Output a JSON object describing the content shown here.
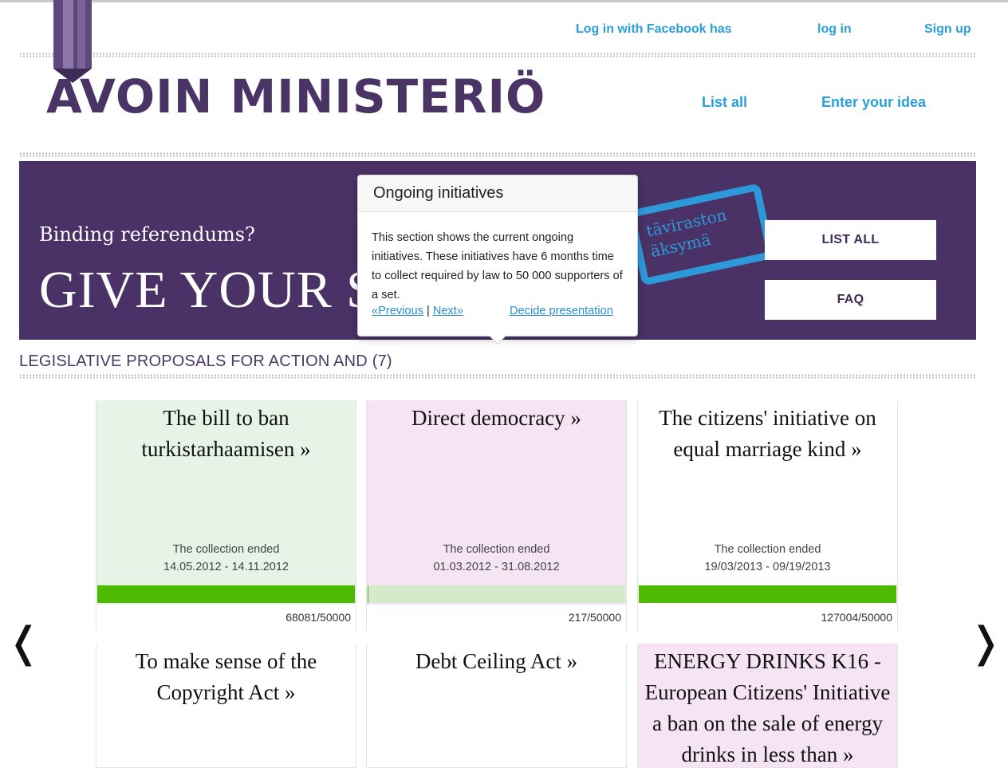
{
  "header": {
    "facebook_login": "Log in with Facebook has",
    "login": "log in",
    "signup": "Sign up",
    "logo_text": "AVOIN MINISTERIÖ",
    "nav": {
      "list_all": "List all",
      "enter_idea": "Enter your idea"
    }
  },
  "banner": {
    "kicker": "Binding referendums?",
    "headline": "GIVE YOUR S",
    "stamp_line1": "täviraston",
    "stamp_line2": "äksymä",
    "list_all_btn": "LIST ALL",
    "faq_btn": "FAQ"
  },
  "popover": {
    "title": "Ongoing initiatives",
    "body": "This section shows the current ongoing initiatives. These initiatives have 6 months time to collect required by law to 50 000 supporters of a set.",
    "previous": "«Previous",
    "separator": "|",
    "next": "Next»",
    "decide": "Decide presentation"
  },
  "section": {
    "title": "LEGISLATIVE PROPOSALS FOR ACTION AND (7)"
  },
  "cards": [
    {
      "title": "The bill to ban turkistarhaamisen »",
      "status": "The collection ended",
      "dates": "14.05.2012 - 14.11.2012",
      "count": "68081/50000",
      "progress": 1.0,
      "bg": "#e5f4e6"
    },
    {
      "title": "Direct democracy »",
      "status": "The collection ended",
      "dates": "01.03.2012 - 31.08.2012",
      "count": "217/50000",
      "progress": 0.004,
      "bg": "#f6e4f4"
    },
    {
      "title": "The citizens' initiative on equal marriage kind »",
      "status": "The collection ended",
      "dates": "19/03/2013 - 09/19/2013",
      "count": "127004/50000",
      "progress": 1.0,
      "bg": "#ffffff"
    },
    {
      "title": "To make sense of the Copyright Act »",
      "bg": "#ffffff"
    },
    {
      "title": "Debt Ceiling Act »",
      "bg": "#ffffff"
    },
    {
      "title": "ENERGY DRINKS K16 - European Citizens' Initiative a ban on the sale of energy drinks in less than »",
      "bg": "#f6e4f4"
    }
  ],
  "carousel": {
    "prev": "❬",
    "next": "❭"
  },
  "colors": {
    "brand_purple": "#4a3266",
    "link_blue": "#2aa0d8",
    "progress_green": "#4cbb00",
    "progress_track": "#d4ebcb"
  }
}
